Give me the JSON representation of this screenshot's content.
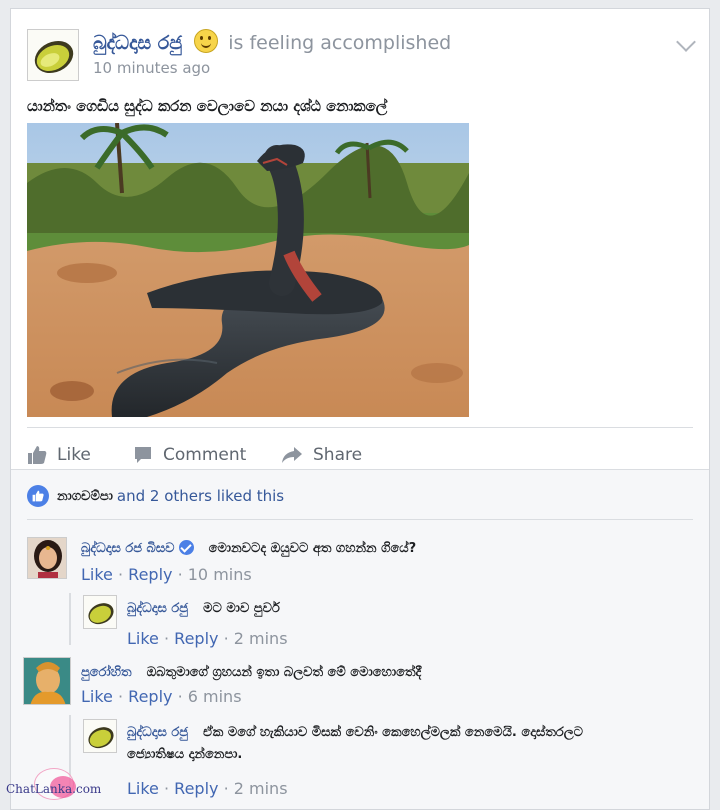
{
  "post": {
    "author": "බුද්ධදාස රජු",
    "feeling": "is feeling accomplished",
    "time": "10 minutes ago",
    "text": "යාන්තං ගෙඩිය සුද්ධ කරන වෙලාවෙ නයා දශ්ඨ නොකලේ"
  },
  "actions": {
    "like": "Like",
    "comment": "Comment",
    "share": "Share"
  },
  "likes": {
    "first_liker": "නාගචම්පා",
    "rest": "and 2 others liked this"
  },
  "comments": [
    {
      "author": "බුද්ධදාස රජ බිසව",
      "verified": true,
      "text": "මොනවටද ඔයුවට අත ගහන්න ගියේ?",
      "like": "Like",
      "reply": "Reply",
      "time": "10 mins",
      "replies": [
        {
          "author": "බුද්ධදාස රජු",
          "text": "මට මාව පුවර්",
          "like": "Like",
          "reply": "Reply",
          "time": "2 mins"
        }
      ]
    },
    {
      "author": "පුරෝහිත",
      "verified": false,
      "text": "ඔබතුමාගේ ග්‍රහයන් ඉතා බලවත් මේ මොහොතේදී",
      "like": "Like",
      "reply": "Reply",
      "time": "6 mins",
      "replies": [
        {
          "author": "බුද්ධදාස රජු",
          "text": "ඒක මගේ හැකියාව මිසක් වෙනිං කෙහෙල්මලක් නෙමෙයි. දොස්තරලට",
          "text2": "ජ්‍යොතිෂය දාන්නෙපා.",
          "like": "Like",
          "reply": "Reply",
          "time": "2 mins"
        }
      ]
    }
  ],
  "watermark": "ChatLanka.com",
  "colors": {
    "link": "#365899",
    "meta": "#8d949e",
    "background": "#e9ebee",
    "like_blue": "#4c80e6"
  }
}
